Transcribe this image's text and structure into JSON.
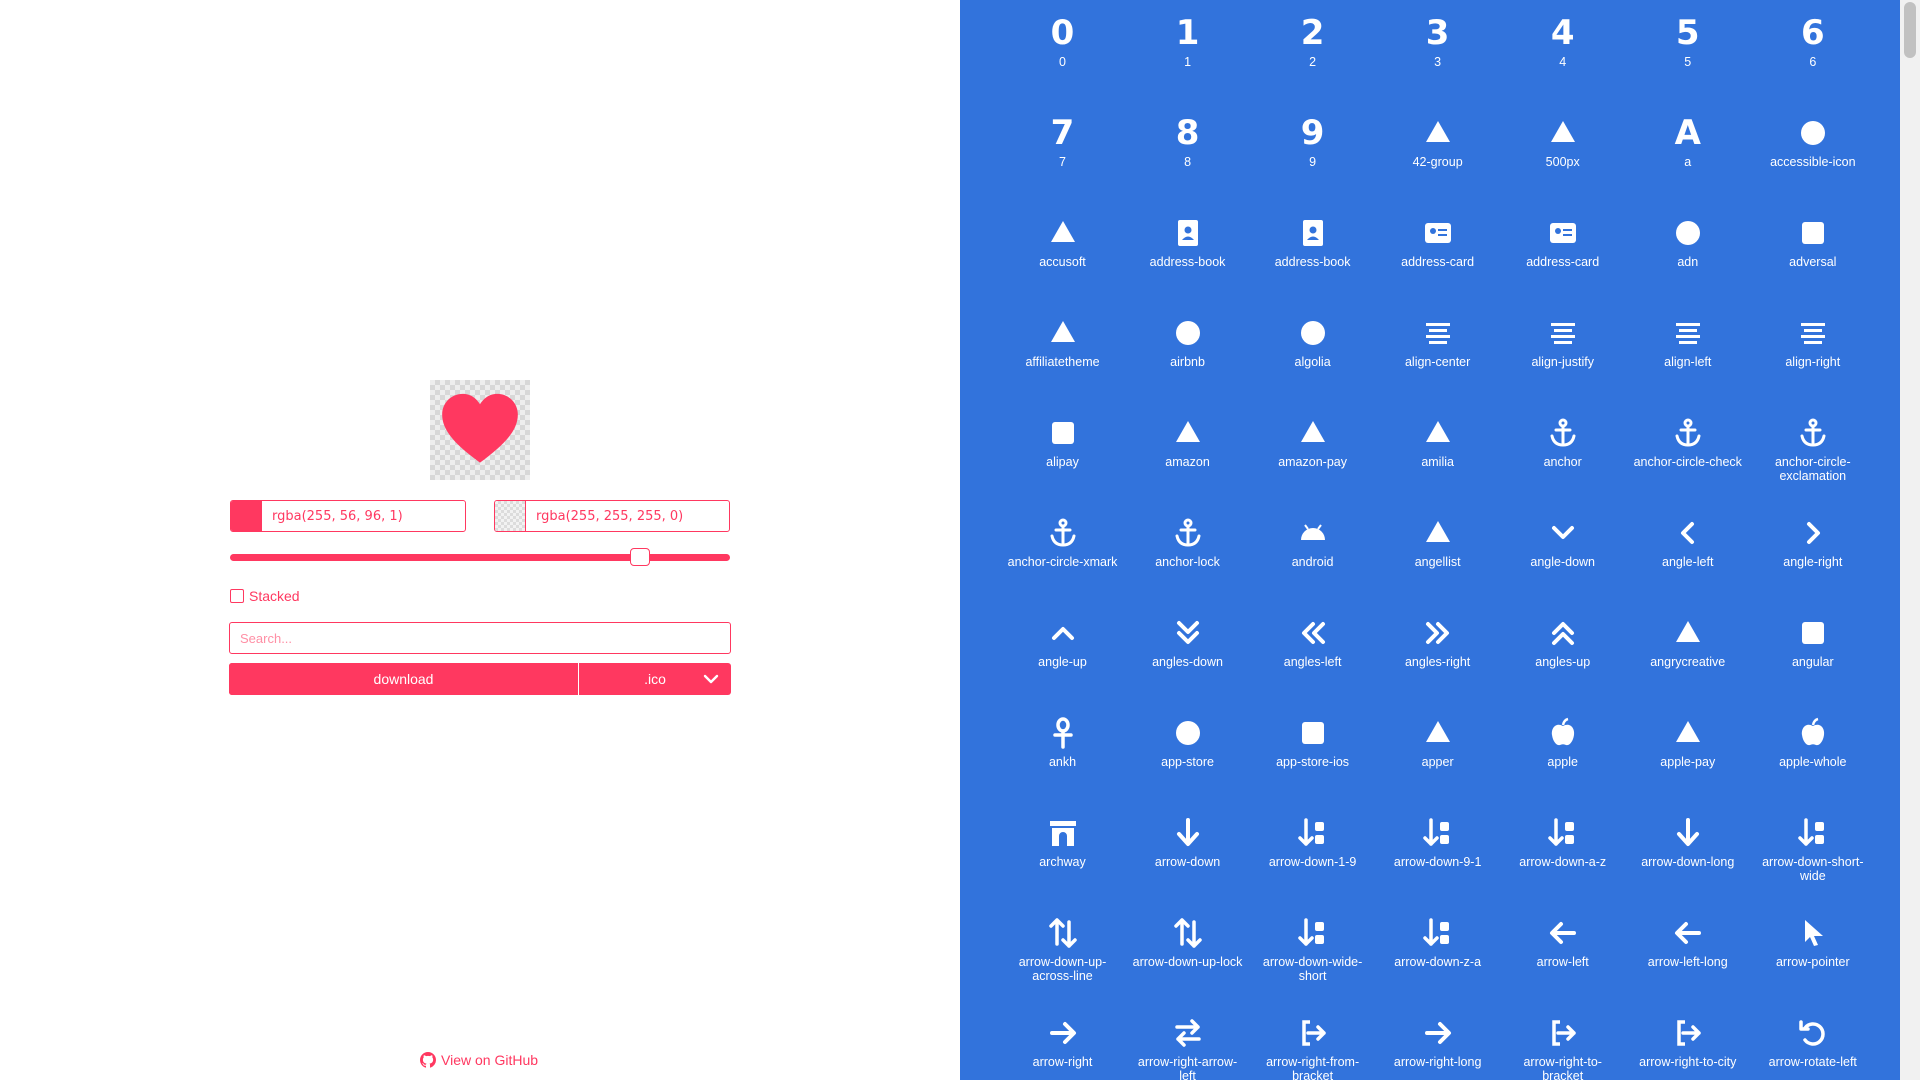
{
  "editor": {
    "foreground": {
      "value": "rgba(255, 56, 96, 1)",
      "color": "#ff3860"
    },
    "background": {
      "value": "rgba(255, 255, 255, 0)"
    },
    "size_slider": {
      "level": 0.82
    },
    "stacked": {
      "label": "Stacked",
      "checked": false
    },
    "search": {
      "placeholder": "Search...",
      "value": ""
    },
    "download": {
      "label": "download"
    },
    "format": {
      "selected": ".ico"
    },
    "github": {
      "label": "View on GitHub"
    }
  },
  "theme": {
    "accent": "#ff3860",
    "panel": "#3273dc"
  },
  "icons": [
    {
      "name": "0",
      "glyph": "0"
    },
    {
      "name": "1",
      "glyph": "1"
    },
    {
      "name": "2",
      "glyph": "2"
    },
    {
      "name": "3",
      "glyph": "3"
    },
    {
      "name": "4",
      "glyph": "4"
    },
    {
      "name": "5",
      "glyph": "5"
    },
    {
      "name": "6",
      "glyph": "6"
    },
    {
      "name": "7",
      "glyph": "7"
    },
    {
      "name": "8",
      "glyph": "8"
    },
    {
      "name": "9",
      "glyph": "9"
    },
    {
      "name": "42-group",
      "glyph": ""
    },
    {
      "name": "500px",
      "glyph": ""
    },
    {
      "name": "a",
      "glyph": "A"
    },
    {
      "name": "accessible-icon",
      "glyph": ""
    },
    {
      "name": "accusoft",
      "glyph": ""
    },
    {
      "name": "address-book",
      "glyph": ""
    },
    {
      "name": "address-book",
      "glyph": ""
    },
    {
      "name": "address-card",
      "glyph": ""
    },
    {
      "name": "address-card",
      "glyph": ""
    },
    {
      "name": "adn",
      "glyph": ""
    },
    {
      "name": "adversal",
      "glyph": ""
    },
    {
      "name": "affiliatetheme",
      "glyph": ""
    },
    {
      "name": "airbnb",
      "glyph": ""
    },
    {
      "name": "algolia",
      "glyph": ""
    },
    {
      "name": "align-center",
      "glyph": ""
    },
    {
      "name": "align-justify",
      "glyph": ""
    },
    {
      "name": "align-left",
      "glyph": ""
    },
    {
      "name": "align-right",
      "glyph": ""
    },
    {
      "name": "alipay",
      "glyph": ""
    },
    {
      "name": "amazon",
      "glyph": ""
    },
    {
      "name": "amazon-pay",
      "glyph": ""
    },
    {
      "name": "amilia",
      "glyph": ""
    },
    {
      "name": "anchor",
      "glyph": ""
    },
    {
      "name": "anchor-circle-check",
      "glyph": ""
    },
    {
      "name": "anchor-circle-exclamation",
      "glyph": ""
    },
    {
      "name": "anchor-circle-xmark",
      "glyph": ""
    },
    {
      "name": "anchor-lock",
      "glyph": ""
    },
    {
      "name": "android",
      "glyph": ""
    },
    {
      "name": "angellist",
      "glyph": ""
    },
    {
      "name": "angle-down",
      "glyph": ""
    },
    {
      "name": "angle-left",
      "glyph": ""
    },
    {
      "name": "angle-right",
      "glyph": ""
    },
    {
      "name": "angle-up",
      "glyph": ""
    },
    {
      "name": "angles-down",
      "glyph": ""
    },
    {
      "name": "angles-left",
      "glyph": ""
    },
    {
      "name": "angles-right",
      "glyph": ""
    },
    {
      "name": "angles-up",
      "glyph": ""
    },
    {
      "name": "angrycreative",
      "glyph": ""
    },
    {
      "name": "angular",
      "glyph": ""
    },
    {
      "name": "ankh",
      "glyph": ""
    },
    {
      "name": "app-store",
      "glyph": ""
    },
    {
      "name": "app-store-ios",
      "glyph": ""
    },
    {
      "name": "apper",
      "glyph": ""
    },
    {
      "name": "apple",
      "glyph": ""
    },
    {
      "name": "apple-pay",
      "glyph": ""
    },
    {
      "name": "apple-whole",
      "glyph": ""
    },
    {
      "name": "archway",
      "glyph": ""
    },
    {
      "name": "arrow-down",
      "glyph": ""
    },
    {
      "name": "arrow-down-1-9",
      "glyph": ""
    },
    {
      "name": "arrow-down-9-1",
      "glyph": ""
    },
    {
      "name": "arrow-down-a-z",
      "glyph": ""
    },
    {
      "name": "arrow-down-long",
      "glyph": ""
    },
    {
      "name": "arrow-down-short-wide",
      "glyph": ""
    },
    {
      "name": "arrow-down-up-across-line",
      "glyph": ""
    },
    {
      "name": "arrow-down-up-lock",
      "glyph": ""
    },
    {
      "name": "arrow-down-wide-short",
      "glyph": ""
    },
    {
      "name": "arrow-down-z-a",
      "glyph": ""
    },
    {
      "name": "arrow-left",
      "glyph": ""
    },
    {
      "name": "arrow-left-long",
      "glyph": ""
    },
    {
      "name": "arrow-pointer",
      "glyph": ""
    },
    {
      "name": "arrow-right",
      "glyph": ""
    },
    {
      "name": "arrow-right-arrow-left",
      "glyph": ""
    },
    {
      "name": "arrow-right-from-bracket",
      "glyph": ""
    },
    {
      "name": "arrow-right-long",
      "glyph": ""
    },
    {
      "name": "arrow-right-to-bracket",
      "glyph": ""
    },
    {
      "name": "arrow-right-to-city",
      "glyph": ""
    },
    {
      "name": "arrow-rotate-left",
      "glyph": ""
    }
  ]
}
